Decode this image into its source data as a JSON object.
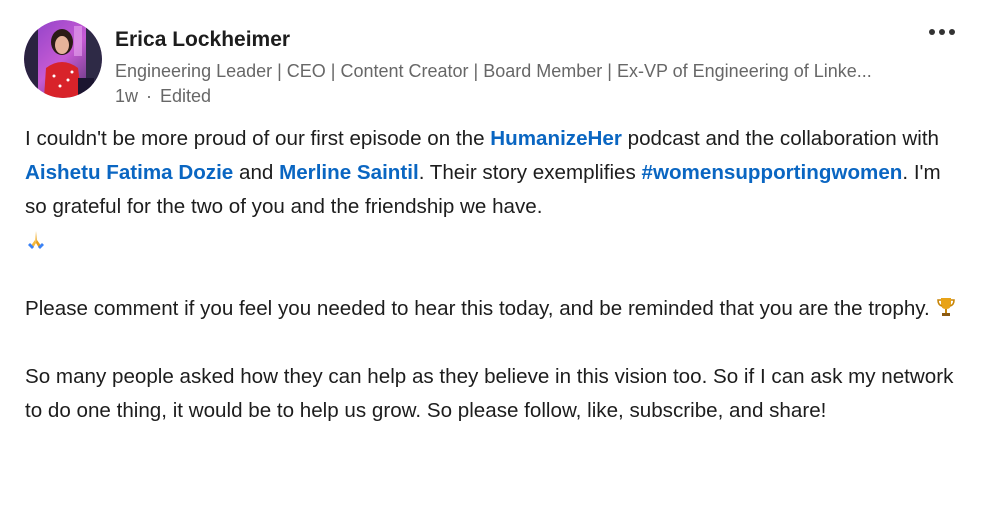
{
  "author": {
    "name": "Erica Lockheimer",
    "headline": "Engineering Leader | CEO | Content Creator | Board Member | Ex-VP of Engineering of Linke...",
    "time": "1w",
    "separator": "·",
    "edited": "Edited"
  },
  "post": {
    "p1": {
      "t1": "I couldn't be more proud of our first episode on the ",
      "link_podcast": "HumanizeHer",
      "t2": " podcast and the collaboration with ",
      "mention1": "Aishetu Fatima Dozie",
      "t3": " and ",
      "mention2": "Merline Saintil",
      "t4": ".  Their story exemplifies ",
      "hashtag": "#womensupportingwomen",
      "t5": ". I'm so grateful for the two of you and the friendship we have."
    },
    "p2": {
      "t1": "Please comment if you feel you needed to hear this today, and be reminded that you are the trophy."
    },
    "p3": {
      "t1": "So many people asked how they can help as they believe in this vision too.  So if I can ask my network to do one thing, it would be to help us grow. So please follow, like, subscribe, and share!"
    }
  },
  "icons": {
    "avatar": "profile-photo",
    "more": "more-options-icon",
    "pray": "folded-hands-emoji",
    "trophy": "trophy-emoji"
  },
  "colors": {
    "link": "#0a66c2",
    "text": "#1d1d1d",
    "muted": "#676767"
  }
}
